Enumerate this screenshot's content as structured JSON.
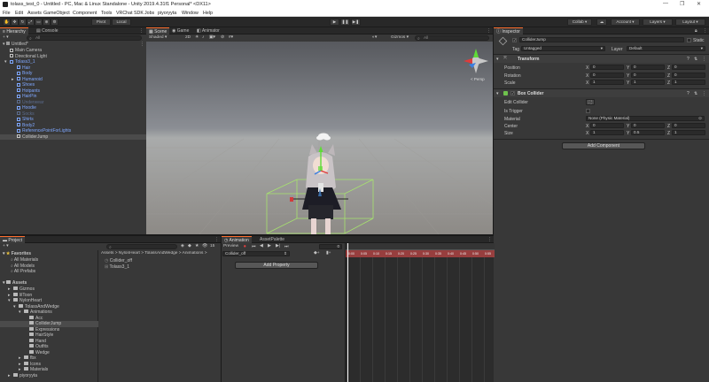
{
  "window": {
    "title": "tolass_test_0 - Untitled - PC, Mac & Linux Standalone - Unity 2019.4.31f1 Personal* <DX11>",
    "controls": [
      "—",
      "❐",
      "✕"
    ]
  },
  "menu": [
    "File",
    "Edit",
    "Assets",
    "GameObject",
    "Component",
    "Tools",
    "VRChat SDK",
    "Jobs",
    "piyoryyta",
    "Window",
    "Help"
  ],
  "toolbar": {
    "pivot": "Pivot",
    "local": "Local",
    "collab": "Collab",
    "account": "Account",
    "layers": "Layers",
    "layout": "Layout",
    "play_icons": [
      "▶",
      "❚❚",
      "▶❚"
    ]
  },
  "hierarchy": {
    "tabs": [
      "Hierarchy",
      "Console"
    ],
    "create": "+ ▾",
    "search": "All",
    "scene": "Untitled*",
    "items": [
      {
        "label": "Main Camera",
        "depth": 1,
        "color": "#c4c4c4",
        "fold": ""
      },
      {
        "label": "Directional Light",
        "depth": 1,
        "color": "#c4c4c4",
        "fold": ""
      },
      {
        "label": "Tolass3_1",
        "depth": 1,
        "color": "#7ea7ff",
        "fold": "▾"
      },
      {
        "label": "Hair",
        "depth": 2,
        "color": "#7ea7ff",
        "fold": ""
      },
      {
        "label": "Body",
        "depth": 2,
        "color": "#7ea7ff",
        "fold": ""
      },
      {
        "label": "Humanoid",
        "depth": 2,
        "color": "#7ea7ff",
        "fold": "▸"
      },
      {
        "label": "Shoes",
        "depth": 2,
        "color": "#7ea7ff",
        "fold": ""
      },
      {
        "label": "Hotpants",
        "depth": 2,
        "color": "#7ea7ff",
        "fold": ""
      },
      {
        "label": "HairPin",
        "depth": 2,
        "color": "#7ea7ff",
        "fold": ""
      },
      {
        "label": "Underwear",
        "depth": 2,
        "color": "#5b6c8e",
        "fold": ""
      },
      {
        "label": "Hoodie",
        "depth": 2,
        "color": "#7ea7ff",
        "fold": ""
      },
      {
        "label": "Socks",
        "depth": 2,
        "color": "#5b6c8e",
        "fold": ""
      },
      {
        "label": "Shirts",
        "depth": 2,
        "color": "#7ea7ff",
        "fold": ""
      },
      {
        "label": "Body2",
        "depth": 2,
        "color": "#7ea7ff",
        "fold": ""
      },
      {
        "label": "ReferencePointForLights",
        "depth": 2,
        "color": "#7ea7ff",
        "fold": ""
      },
      {
        "label": "ColliderJump",
        "depth": 2,
        "color": "#c4c4c4",
        "fold": "",
        "selected": true
      }
    ]
  },
  "scene": {
    "tabs": [
      "Scene",
      "Game",
      "Animator"
    ],
    "shading": "Shaded",
    "mode2d": "2D",
    "gizmos": "Gizmos",
    "search": "All",
    "persp": "< Persp"
  },
  "inspector": {
    "tab": "Inspector",
    "object_name": "ColliderJump",
    "static": "Static",
    "tag_label": "Tag",
    "tag": "Untagged",
    "layer_label": "Layer",
    "layer": "Default",
    "transform": {
      "title": "Transform",
      "rows": [
        {
          "label": "Position",
          "x": "0",
          "y": "0",
          "z": "0"
        },
        {
          "label": "Rotation",
          "x": "0",
          "y": "0",
          "z": "0"
        },
        {
          "label": "Scale",
          "x": "1",
          "y": "1",
          "z": "1"
        }
      ]
    },
    "box": {
      "title": "Box Collider",
      "edit": "Edit Collider",
      "trigger": "Is Trigger",
      "material_label": "Material",
      "material": "None (Physic Material)",
      "center_label": "Center",
      "center": {
        "x": "0",
        "y": "0",
        "z": "0"
      },
      "size_label": "Size",
      "size": {
        "x": "1",
        "y": "0.5",
        "z": "1"
      }
    },
    "add_component": "Add Component"
  },
  "project": {
    "tab": "Project",
    "create": "+ ▾",
    "count": "15",
    "favorites": {
      "label": "Favorites",
      "items": [
        "All Materials",
        "All Models",
        "All Prefabs"
      ]
    },
    "assets_label": "Assets",
    "tree": [
      {
        "label": "Gizmos",
        "depth": 1,
        "fold": "▸"
      },
      {
        "label": "lilToon",
        "depth": 1,
        "fold": "▸"
      },
      {
        "label": "NylonHeart",
        "depth": 1,
        "fold": "▾"
      },
      {
        "label": "TolassAndWedge",
        "depth": 2,
        "fold": "▾"
      },
      {
        "label": "Animations",
        "depth": 3,
        "fold": "▾"
      },
      {
        "label": "Acc",
        "depth": 4,
        "fold": ""
      },
      {
        "label": "ColliderJump",
        "depth": 4,
        "fold": "",
        "selected": true
      },
      {
        "label": "Expressions",
        "depth": 4,
        "fold": ""
      },
      {
        "label": "HairStyle",
        "depth": 4,
        "fold": ""
      },
      {
        "label": "Hand",
        "depth": 4,
        "fold": ""
      },
      {
        "label": "Outfits",
        "depth": 4,
        "fold": ""
      },
      {
        "label": "Wedge",
        "depth": 4,
        "fold": ""
      },
      {
        "label": "fbx",
        "depth": 3,
        "fold": "▸"
      },
      {
        "label": "Icons",
        "depth": 3,
        "fold": "▸"
      },
      {
        "label": "Materials",
        "depth": 3,
        "fold": "▸"
      },
      {
        "label": "piyoryyta",
        "depth": 1,
        "fold": "▸"
      }
    ],
    "breadcrumb": "Assets > NylonHeart > TolassAndWedge > Animations >",
    "files": [
      "Collider_off",
      "Tolass3_1"
    ]
  },
  "animation": {
    "tabs": [
      "Animation",
      "AssetPalette"
    ],
    "preview": "Preview",
    "frame": "0",
    "clip": "Collider_off",
    "add_property": "Add Property",
    "ticks": [
      "0:00",
      "0:05",
      "0:10",
      "0:15",
      "0:20",
      "0:25",
      "0:30",
      "0:35",
      "0:40",
      "0:45",
      "0:50",
      "0:55"
    ],
    "transport": [
      "⏺",
      "⏮",
      "◀",
      "▶",
      "▶|",
      "⏭"
    ]
  }
}
